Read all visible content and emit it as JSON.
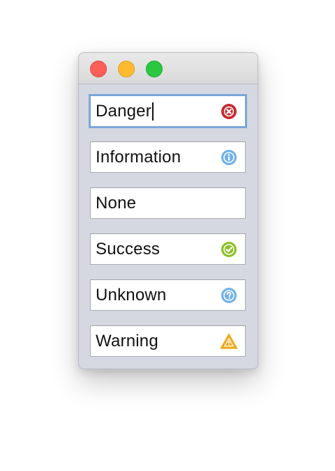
{
  "window": {
    "controls": [
      "close",
      "minimize",
      "zoom"
    ]
  },
  "fields": [
    {
      "value": "Danger",
      "icon": "error-circle-icon",
      "color": "#c8282e",
      "focused": true
    },
    {
      "value": "Information",
      "icon": "info-circle-icon",
      "color": "#6fb1ea"
    },
    {
      "value": "None",
      "icon": ""
    },
    {
      "value": "Success",
      "icon": "check-circle-icon",
      "color": "#8cbf26"
    },
    {
      "value": "Unknown",
      "icon": "question-circle-icon",
      "color": "#6fb1ea"
    },
    {
      "value": "Warning",
      "icon": "warning-triangle-icon",
      "color": "#f0a818"
    }
  ]
}
